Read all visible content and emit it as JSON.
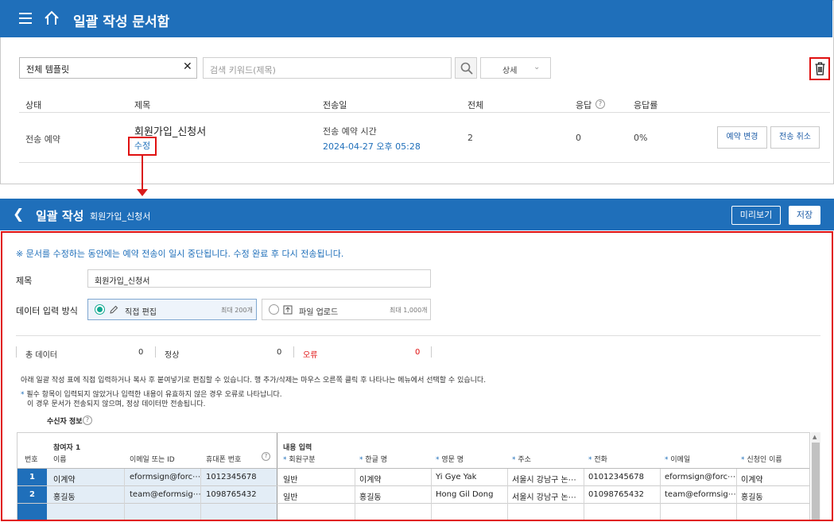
{
  "top": {
    "title": "일괄 작성 문서함",
    "template_filter": "전체 템플릿",
    "search_placeholder": "검색 키워드(제목)",
    "detail_label": "상세",
    "columns": [
      "상태",
      "제목",
      "전송일",
      "전체",
      "응답",
      "응답률"
    ],
    "row": {
      "status": "전송 예약",
      "title": "회원가입_신청서",
      "edit_label": "수정",
      "send_label": "전송 예약 시간",
      "send_date": "2024-04-27 오후 05:28",
      "total": "2",
      "responses": "0",
      "rate": "0%",
      "change_button": "예약 변경",
      "cancel_button": "전송 취소"
    }
  },
  "editor": {
    "header_title": "일괄 작성",
    "header_doc": "회원가입_신청서",
    "preview_button": "미리보기",
    "save_button": "저장",
    "notice": "※ 문서를 수정하는 동안에는 예약 전송이 일시 중단됩니다. 수정 완료 후 다시 전송됩니다.",
    "title_label": "제목",
    "title_value": "회원가입_신청서",
    "input_method_label": "데이터 입력 방식",
    "option_direct": "직접 편집",
    "option_direct_max": "최대 200개",
    "option_upload": "파일 업로드",
    "option_upload_max": "최대 1,000개",
    "stats": {
      "total_label": "총 데이터",
      "total": "0",
      "normal_label": "정상",
      "normal": "0",
      "error_label": "오류",
      "error": "0"
    },
    "desc1": "아래 일괄 작성 표에 직접 입력하거나 복사 후 붙여넣기로 편집할 수 있습니다. 행 추가/삭제는 마우스 오른쪽 클릭 후 나타나는 메뉴에서 선택할 수 있습니다.",
    "desc2": "필수 항목이 입력되지 않았거나 입력한 내용이 유효하지 않은 경우 오류로 나타납니다.",
    "desc3": "이 경우 문서가 전송되지 않으며, 정상 데이터만 전송됩니다.",
    "recipient_label": "수신자 정보",
    "grid": {
      "no_label": "번호",
      "participant_group": "참여자 1",
      "content_group": "내용 입력",
      "participant_cols": [
        "이름",
        "이메일 또는 ID",
        "휴대폰 번호"
      ],
      "content_cols": [
        "회원구분",
        "한글 명",
        "영문 명",
        "주소",
        "전화",
        "이메일",
        "신청인 이름"
      ],
      "rows": [
        {
          "no": "1",
          "cells": [
            "이계약",
            "eformsign@forc⋯",
            "1012345678",
            "일반",
            "이계약",
            "Yi Gye Yak",
            "서울시 강남구 논⋯",
            "01012345678",
            "eformsign@forc⋯",
            "이계약"
          ]
        },
        {
          "no": "2",
          "cells": [
            "홍길동",
            "team@eformsig⋯",
            "1098765432",
            "일반",
            "홍길동",
            "Hong Gil Dong",
            "서울시 강남구 논⋯",
            "01098765432",
            "team@eformsig⋯",
            "홍길동"
          ]
        }
      ]
    }
  }
}
